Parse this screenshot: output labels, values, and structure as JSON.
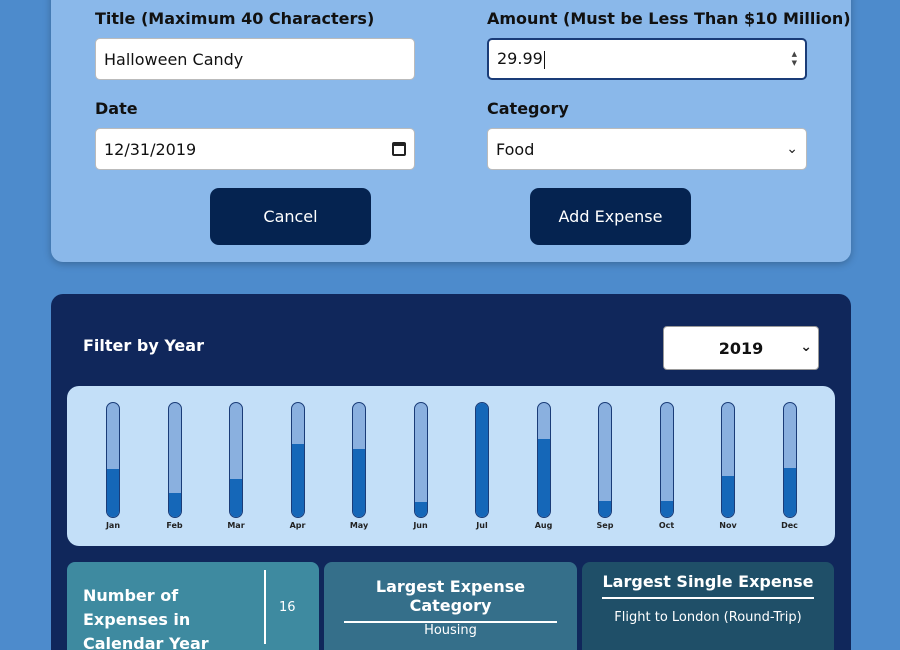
{
  "form": {
    "title_label": "Title (Maximum 40 Characters)",
    "title_value": "Halloween Candy",
    "amount_label": "Amount (Must be Less Than $10 Million)",
    "amount_value": "29.99",
    "date_label": "Date",
    "date_value": "12/31/2019",
    "category_label": "Category",
    "category_value": "Food",
    "cancel_label": "Cancel",
    "add_label": "Add Expense"
  },
  "filter": {
    "label": "Filter by Year",
    "selected_year": "2019"
  },
  "chart_data": {
    "type": "bar",
    "categories": [
      "Jan",
      "Feb",
      "Mar",
      "Apr",
      "May",
      "Jun",
      "Jul",
      "Aug",
      "Sep",
      "Oct",
      "Nov",
      "Dec"
    ],
    "values": [
      0.42,
      0.21,
      0.33,
      0.64,
      0.6,
      0.13,
      1.0,
      0.68,
      0.14,
      0.14,
      0.36,
      0.43
    ],
    "ylim": [
      0,
      1
    ],
    "fill_color": "#1567b8",
    "track_color": "#8ab0df"
  },
  "stats": {
    "count_label": "Number of Expenses in Calendar Year",
    "count_value": "16",
    "category_title": "Largest Expense Category",
    "category_value": "Housing",
    "single_title": "Largest Single Expense",
    "single_value": "Flight to London (Round-Trip)"
  },
  "colors": {
    "background": "#4d8bcc",
    "form_card": "#8ab8ea",
    "panel": "#10275b",
    "button": "#052350"
  }
}
